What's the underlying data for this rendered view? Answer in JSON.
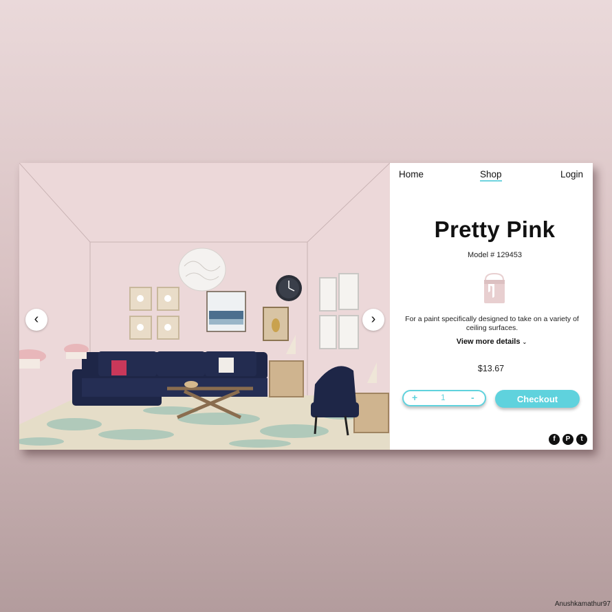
{
  "nav": {
    "home": "Home",
    "shop": "Shop",
    "login": "Login"
  },
  "product": {
    "name": "Pretty Pink",
    "model": "Model # 129453",
    "description": "For a paint specifically designed to take on a variety of ceiling surfaces.",
    "more_label": "View more details",
    "price": "$13.67",
    "color": "#ecd8d9",
    "icon": "paint-can-icon"
  },
  "cart": {
    "quantity": "1",
    "increment": "+",
    "decrement": "-",
    "checkout": "Checkout"
  },
  "social": {
    "facebook": "f",
    "pinterest": "P",
    "twitter": "t"
  },
  "carousel": {
    "prev": "‹",
    "next": "›"
  },
  "credit": "Anushkamathur97",
  "colors": {
    "accent": "#5fd2dd",
    "wall": "#ecd8d9",
    "sofa": "#1e2647",
    "rug": "#a7c6b8"
  }
}
